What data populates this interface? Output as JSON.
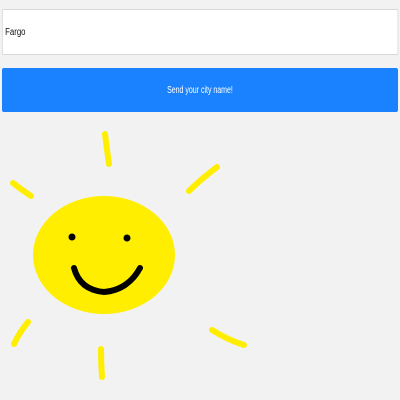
{
  "form": {
    "city_value": "Fargo",
    "send_button_label": "Send your city name!"
  },
  "illustration": {
    "subject": "smiling-sun",
    "face_color": "#ffee00",
    "ray_color": "#ffee00",
    "feature_color": "#000000"
  },
  "colors": {
    "background": "#f2f2f2",
    "button": "#1a82ff",
    "button_text": "#ffffff",
    "input_background": "#ffffff"
  }
}
